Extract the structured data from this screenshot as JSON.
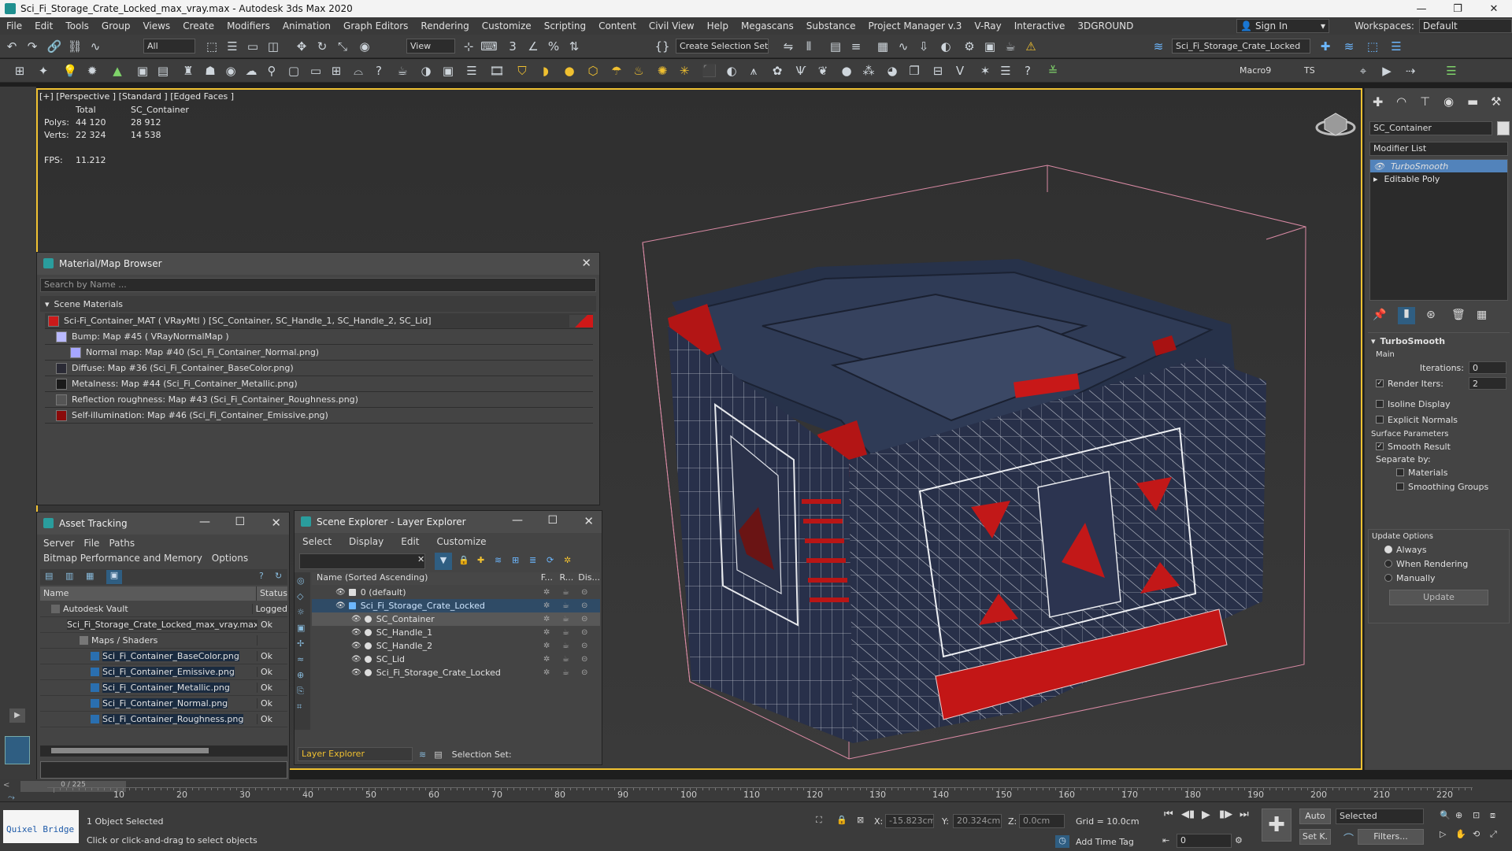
{
  "window": {
    "title": "Sci_Fi_Storage_Crate_Locked_max_vray.max - Autodesk 3ds Max 2020",
    "min": "—",
    "max": "❐",
    "close": "✕"
  },
  "menu": [
    "File",
    "Edit",
    "Tools",
    "Group",
    "Views",
    "Create",
    "Modifiers",
    "Animation",
    "Graph Editors",
    "Rendering",
    "Customize",
    "Scripting",
    "Content",
    "Civil View",
    "Help",
    "Megascans",
    "Substance",
    "Project Manager v.3",
    "V-Ray",
    "Interactive",
    "3DGROUND"
  ],
  "signin": {
    "label": "Sign In"
  },
  "workspaces": {
    "label": "Workspaces:",
    "value": "Default"
  },
  "toolbar": {
    "filter": "All",
    "view": "View",
    "selection_set": "Create Selection Set",
    "layer": "Sci_Fi_Storage_Crate_Locked",
    "macro": "Macro9",
    "ts": "TS"
  },
  "viewport": {
    "label": "[+] [Perspective ] [Standard ] [Edged Faces ]",
    "stats": {
      "h_total": "Total",
      "h_obj": "SC_Container",
      "polys_label": "Polys:",
      "polys_total": "44 120",
      "polys_obj": "28 912",
      "verts_label": "Verts:",
      "verts_total": "22 324",
      "verts_obj": "14 538",
      "fps_label": "FPS:",
      "fps": "11.212"
    }
  },
  "material_browser": {
    "title": "Material/Map Browser",
    "search": "Search by Name ...",
    "group": "Scene Materials",
    "items": [
      {
        "text": "Sci-Fi_Container_MAT  ( VRayMtl ) [SC_Container, SC_Handle_1, SC_Handle_2, SC_Lid]",
        "swatch": "#cc1a1a"
      },
      {
        "text": "Bump: Map #45  ( VRayNormalMap )",
        "swatch": "#b9b9ff"
      },
      {
        "text": "Normal map: Map #40 (Sci_Fi_Container_Normal.png)",
        "swatch": "#a6a6ff"
      },
      {
        "text": "Diffuse: Map #36 (Sci_Fi_Container_BaseColor.png)",
        "swatch": "#2a2a35"
      },
      {
        "text": "Metalness: Map #44 (Sci_Fi_Container_Metallic.png)",
        "swatch": "#1a1a1a"
      },
      {
        "text": "Reflection roughness: Map #43 (Sci_Fi_Container_Roughness.png)",
        "swatch": "#555"
      },
      {
        "text": "Self-illumination: Map #46 (Sci_Fi_Container_Emissive.png)",
        "swatch": "#8a0a0a"
      }
    ]
  },
  "asset_tracking": {
    "title": "Asset Tracking",
    "menu": [
      "Server",
      "File",
      "Paths",
      "Bitmap Performance and Memory",
      "Options"
    ],
    "col_name": "Name",
    "col_status": "Status",
    "rows": [
      {
        "name": "Autodesk Vault",
        "status": "Logged"
      },
      {
        "name": "Sci_Fi_Storage_Crate_Locked_max_vray.max",
        "status": "Ok"
      },
      {
        "name": "Maps / Shaders",
        "status": ""
      },
      {
        "name": "Sci_Fi_Container_BaseColor.png",
        "status": "Ok"
      },
      {
        "name": "Sci_Fi_Container_Emissive.png",
        "status": "Ok"
      },
      {
        "name": "Sci_Fi_Container_Metallic.png",
        "status": "Ok"
      },
      {
        "name": "Sci_Fi_Container_Normal.png",
        "status": "Ok"
      },
      {
        "name": "Sci_Fi_Container_Roughness.png",
        "status": "Ok"
      }
    ]
  },
  "scene_explorer": {
    "title": "Scene Explorer - Layer Explorer",
    "menu": [
      "Select",
      "Display",
      "Edit",
      "Customize"
    ],
    "col_name": "Name (Sorted Ascending)",
    "col_f": "F...",
    "col_r": "R...",
    "col_d": "Dis...",
    "rows": [
      {
        "name": "0 (default)"
      },
      {
        "name": "Sci_Fi_Storage_Crate_Locked"
      },
      {
        "name": "SC_Container"
      },
      {
        "name": "SC_Handle_1"
      },
      {
        "name": "SC_Handle_2"
      },
      {
        "name": "SC_Lid"
      },
      {
        "name": "Sci_Fi_Storage_Crate_Locked"
      }
    ],
    "footer_layer": "Layer Explorer",
    "footer_selset": "Selection Set:"
  },
  "command_panel": {
    "object_name": "SC_Container",
    "modifier_list": "Modifier List",
    "stack": [
      "TurboSmooth",
      "Editable Poly"
    ],
    "rollout": "TurboSmooth",
    "main": "Main",
    "iterations_label": "Iterations:",
    "iterations": "0",
    "render_iters_label": "Render Iters:",
    "render_iters": "2",
    "isoline": "Isoline Display",
    "explicit": "Explicit Normals",
    "surface": "Surface Parameters",
    "smooth_result": "Smooth Result",
    "separate_by": "Separate by:",
    "materials": "Materials",
    "smoothing_groups": "Smoothing Groups",
    "update_options": "Update Options",
    "always": "Always",
    "when_rendering": "When Rendering",
    "manually": "Manually",
    "update_btn": "Update"
  },
  "timeline": {
    "ticks": [
      "10",
      "20",
      "30",
      "40",
      "50",
      "60",
      "70",
      "80",
      "90",
      "100",
      "110",
      "120",
      "130",
      "140",
      "150",
      "160",
      "170",
      "180",
      "190",
      "200",
      "210",
      "220"
    ],
    "frame": "0 / 225"
  },
  "status": {
    "selected": "1 Object Selected",
    "hint": "Click or click-and-drag to select objects",
    "quixel": "Quixel Bridge",
    "x_label": "X:",
    "x": "-15.823cm",
    "y_label": "Y:",
    "y": "20.324cm",
    "z_label": "Z:",
    "z": "0.0cm",
    "grid": "Grid = 10.0cm",
    "add_time_tag": "Add Time Tag",
    "auto": "Auto",
    "set_k": "Set K.",
    "selected_dd": "Selected",
    "filters": "Filters...",
    "frame_field": "0"
  }
}
